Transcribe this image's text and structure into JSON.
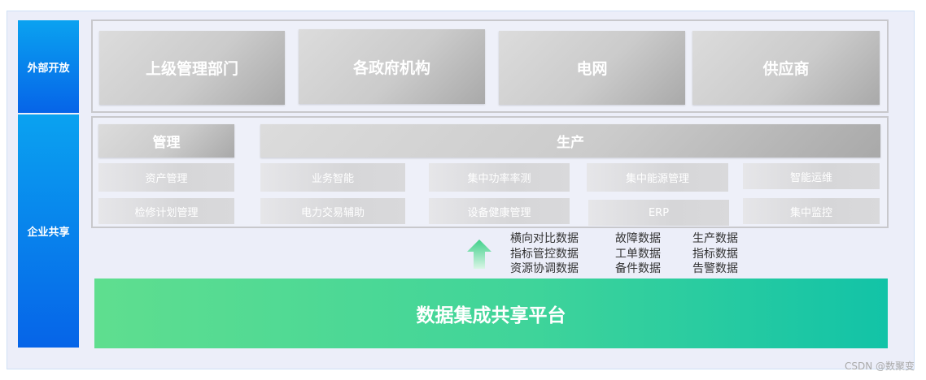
{
  "side_labels": {
    "open": "外部开放",
    "share": "企业共享"
  },
  "external": [
    "上级管理部门",
    "各政府机构",
    "电网",
    "供应商"
  ],
  "management": {
    "title": "管理",
    "items": [
      "资产管理",
      "检修计划管理"
    ]
  },
  "production": {
    "title": "生产",
    "row1": [
      "业务智能",
      "集中功率率测",
      "集中能源管理",
      "智能运维"
    ],
    "row2": [
      "电力交易辅助",
      "设备健康管理",
      "ERP",
      "集中监控"
    ]
  },
  "data_columns": [
    [
      "横向对比数据",
      "指标管控数据",
      "资源协调数据"
    ],
    [
      "故障数据",
      "工单数据",
      "备件数据"
    ],
    [
      "生产数据",
      "指标数据",
      "告警数据"
    ]
  ],
  "platform": "数据集成共享平台",
  "watermark": "CSDN @数聚变"
}
